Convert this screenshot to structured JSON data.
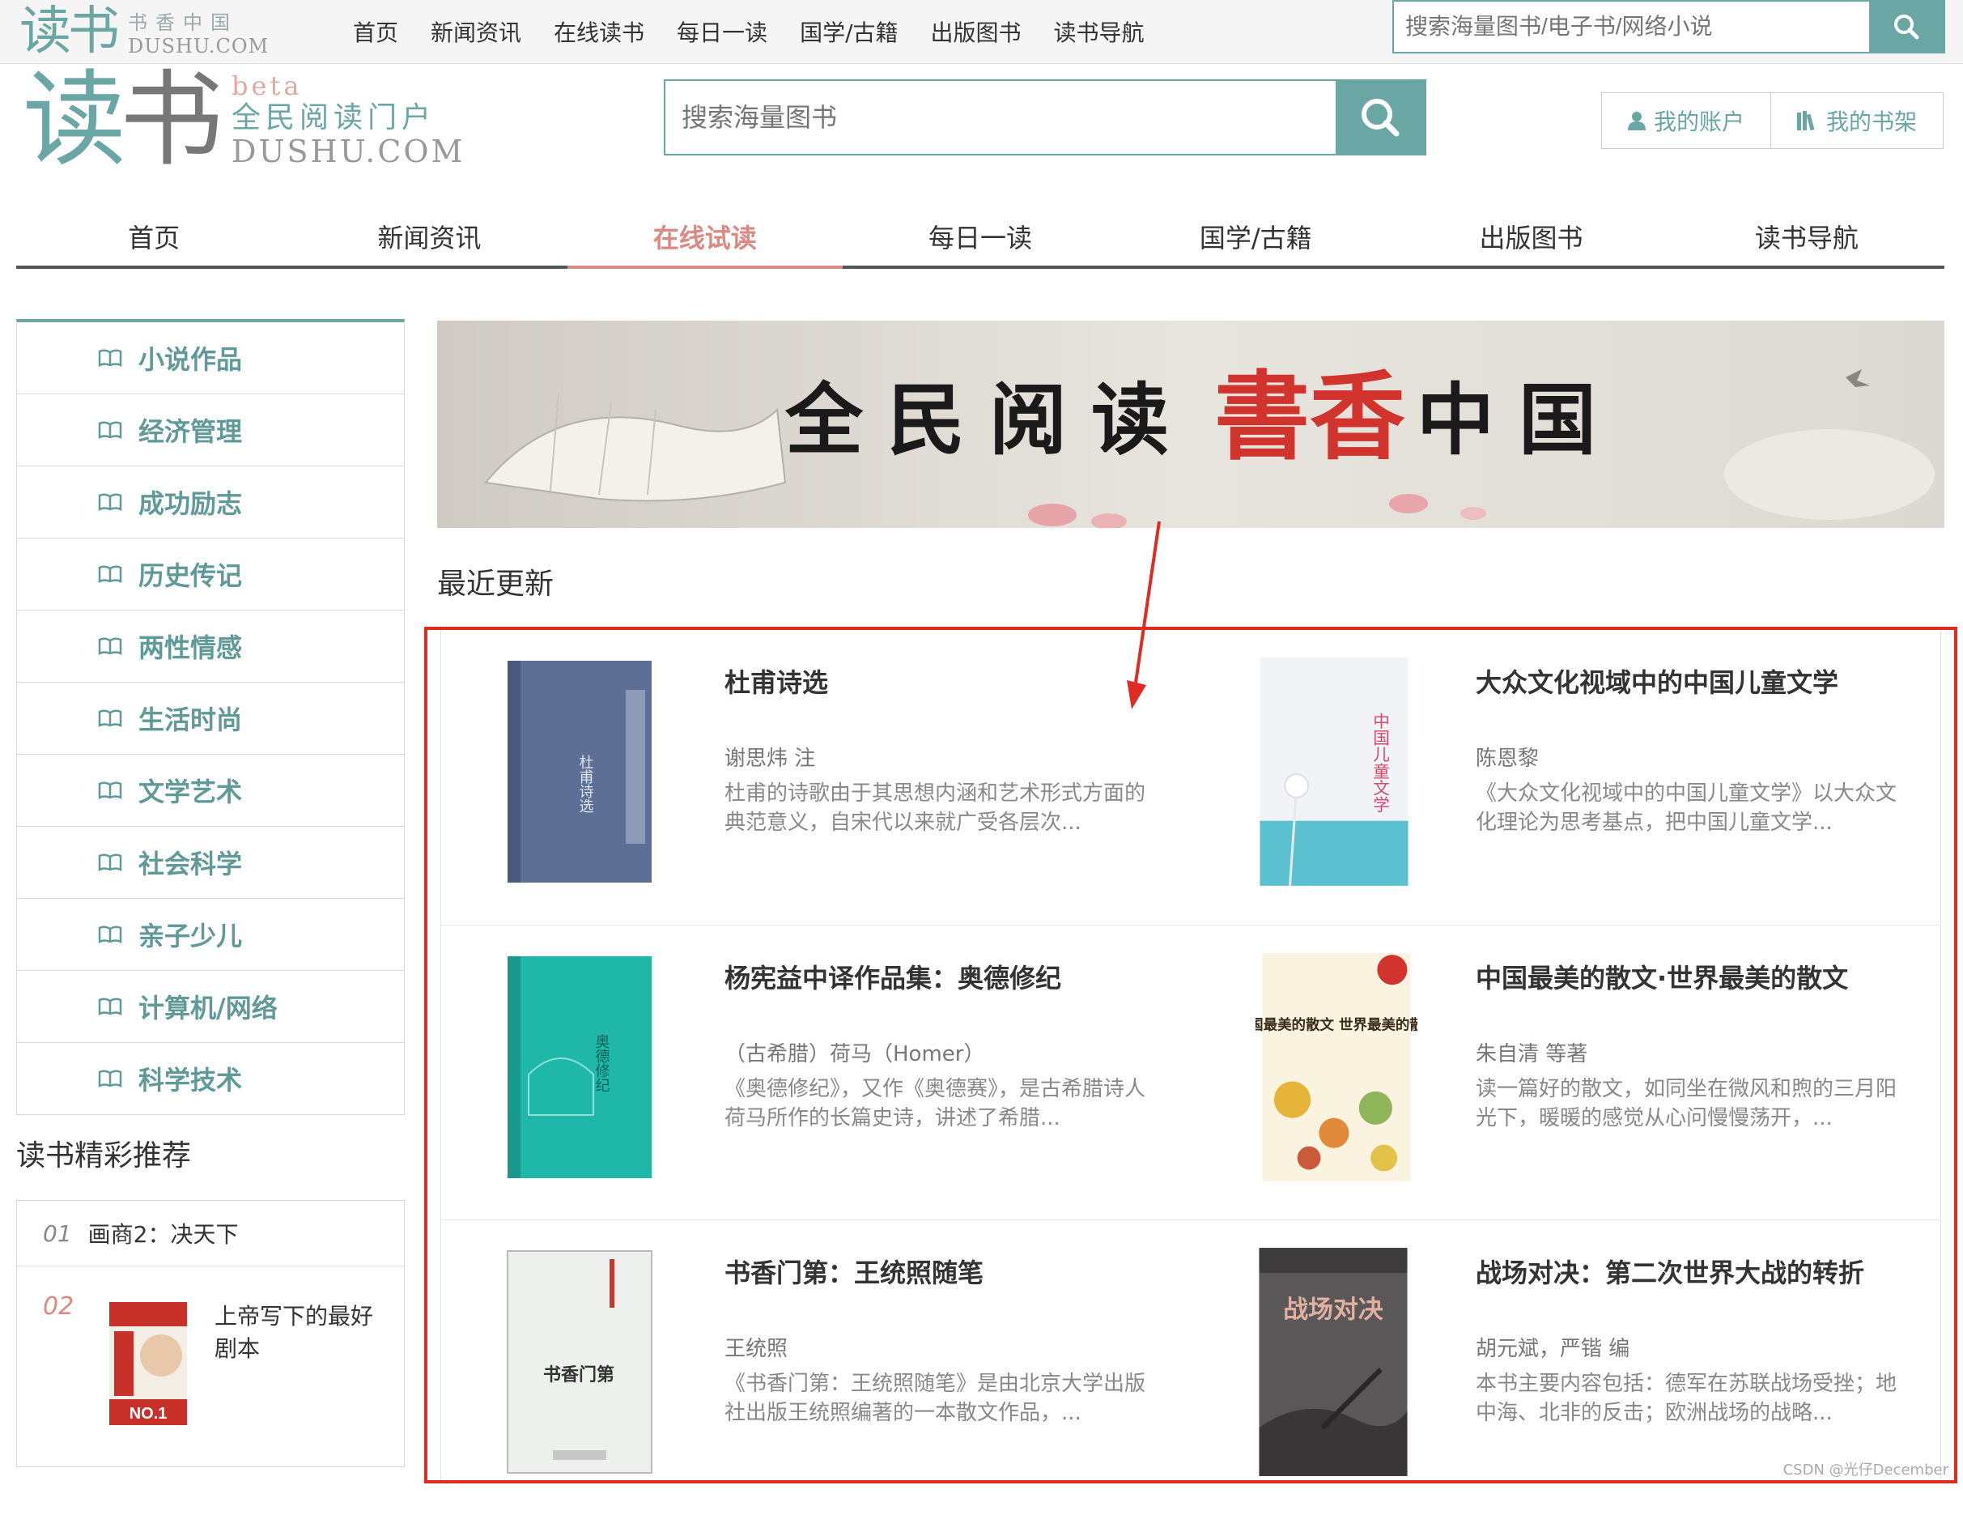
{
  "topbar": {
    "logo_big": "读书",
    "logo_cn": "书香中国",
    "logo_en": "DUSHU.COM",
    "nav": [
      "首页",
      "新闻资讯",
      "在线读书",
      "每日一读",
      "国学/古籍",
      "出版图书",
      "读书导航"
    ],
    "search_placeholder": "搜索海量图书/电子书/网络小说"
  },
  "header": {
    "logo_du": "读",
    "logo_shu": "书",
    "beta": "beta",
    "slogan": "全民阅读门户",
    "domain": "DUSHU.COM",
    "search_placeholder": "搜索海量图书",
    "account_label": "我的账户",
    "shelf_label": "我的书架"
  },
  "mainnav": {
    "items": [
      "首页",
      "新闻资讯",
      "在线试读",
      "每日一读",
      "国学/古籍",
      "出版图书",
      "读书导航"
    ],
    "active_index": 2
  },
  "categories": [
    "小说作品",
    "经济管理",
    "成功励志",
    "历史传记",
    "两性情感",
    "生活时尚",
    "文学艺术",
    "社会科学",
    "亲子少儿",
    "计算机/网络",
    "科学技术"
  ],
  "recommend": {
    "title": "读书精彩推荐",
    "items": [
      {
        "num": "01",
        "title": "画商2：决天下"
      },
      {
        "num": "02",
        "title": "上帝写下的最好剧本"
      }
    ]
  },
  "banner": {
    "text1": "全民阅读",
    "text2": "書香",
    "text3": "中国"
  },
  "recent": {
    "title": "最近更新",
    "books": [
      {
        "title": "杜甫诗选",
        "author": "谢思炜 注",
        "desc": "杜甫的诗歌由于其思想内涵和艺术形式方面的典范意义，自宋代以来就广受各层次..."
      },
      {
        "title": "大众文化视域中的中国儿童文学",
        "author": "陈恩黎",
        "desc": "《大众文化视域中的中国儿童文学》以大众文化理论为思考基点，把中国儿童文学..."
      },
      {
        "title": "杨宪益中译作品集：奥德修纪",
        "author": "（古希腊）荷马（Homer）",
        "desc": "《奥德修纪》，又作《奥德赛》，是古希腊诗人荷马所作的长篇史诗，讲述了希腊..."
      },
      {
        "title": "中国最美的散文·世界最美的散文",
        "author": "朱自清 等著",
        "desc": "读一篇好的散文，如同坐在微风和煦的三月阳光下，暖暖的感觉从心问慢慢荡开，..."
      },
      {
        "title": "书香门第：王统照随笔",
        "author": "王统照",
        "desc": "《书香门第：王统照随笔》是由北京大学出版社出版王统照编著的一本散文作品，..."
      },
      {
        "title": "战场对决：第二次世界大战的转折",
        "author": "胡元斌，严锴 编",
        "desc": "本书主要内容包括：德军在苏联战场受挫；地中海、北非的反击；欧洲战场的战略..."
      }
    ]
  },
  "covers": {
    "c1": "杜甫诗选",
    "c2": "中国儿童文学",
    "c3": "奥德修纪",
    "c4": "中国最美的散文 世界最美的散文",
    "c5": "书香门第",
    "c6": "战场对决"
  },
  "watermark": "CSDN @光仔December",
  "colors": {
    "accent": "#6aa6a4",
    "active": "#d98a82",
    "highlight_border": "#e02a24"
  }
}
